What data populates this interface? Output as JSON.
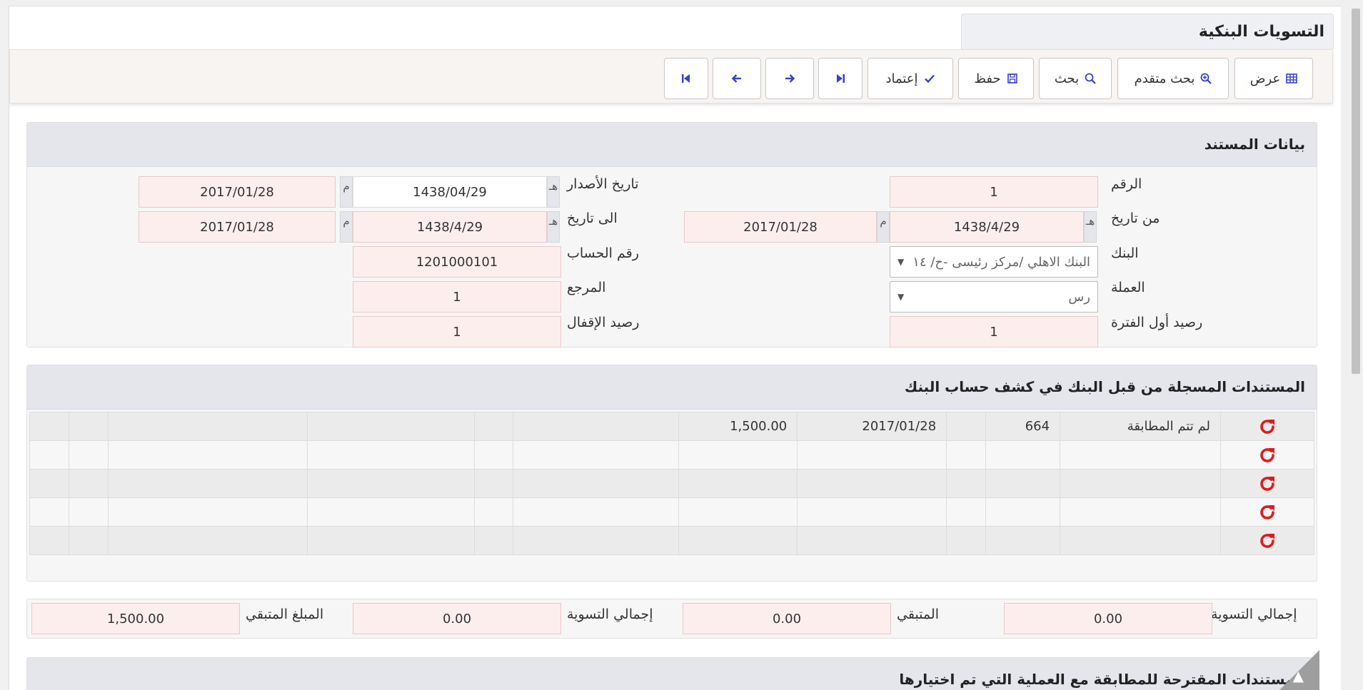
{
  "page": {
    "title": "التسويات البنكية"
  },
  "toolbar": {
    "view": "عرض",
    "advanced_search": "بحث متقدم",
    "search": "بحث",
    "save": "حفظ",
    "approve": "إعتماد"
  },
  "doc": {
    "title": "بيانات المستند",
    "number_label": "الرقم",
    "number_value": "1",
    "issue_date_label": "تاريخ الأصدار",
    "issue_hijri": "1438/04/29",
    "issue_greg": "2017/01/28",
    "from_date_label": "من تاريخ",
    "from_hijri": "1438/4/29",
    "from_greg": "2017/01/28",
    "to_date_label": "الى تاريخ",
    "to_hijri": "1438/4/29",
    "to_greg": "2017/01/28",
    "bank_label": "البنك",
    "bank_value": "البنك الاهلي /مركز رئيسى -ح/ ١٤",
    "account_label": "رقم الحساب",
    "account_value": "1201000101",
    "currency_label": "العملة",
    "currency_value": "رس",
    "reference_label": "المرجع",
    "reference_value": "1",
    "opening_label": "رصيد أول الفترة",
    "opening_value": "1",
    "closing_label": "رصيد الإقفال",
    "closing_value": "1",
    "hijri_suffix": "هـ",
    "greg_suffix": "م"
  },
  "bank_docs": {
    "title": "المستندات المسجلة من قبل البنك في كشف حساب البنك",
    "rows": [
      {
        "status": "لم تتم المطابقة",
        "number": "664",
        "date": "2017/01/28",
        "amount": "1,500.00"
      },
      {
        "status": "",
        "number": "",
        "date": "",
        "amount": ""
      },
      {
        "status": "",
        "number": "",
        "date": "",
        "amount": ""
      },
      {
        "status": "",
        "number": "",
        "date": "",
        "amount": ""
      },
      {
        "status": "",
        "number": "",
        "date": "",
        "amount": ""
      }
    ]
  },
  "totals": {
    "settlement_total_label": "إجمالي التسوية",
    "settlement_total_value": "0.00",
    "remaining_label": "المتبقي",
    "remaining_value": "0.00",
    "settlement_total2_label": "إجمالي التسوية",
    "settlement_total2_value": "0.00",
    "remaining_amount_label": "المبلغ المتبقي",
    "remaining_amount_value": "1,500.00"
  },
  "suggested": {
    "title": "المستندات المقترحة للمطابقة مع العملية التي تم اختيارها"
  },
  "colors": {
    "accent_icon": "#3a3fc4",
    "refresh": "#e01b1b",
    "input_bg": "#fdeeee"
  }
}
